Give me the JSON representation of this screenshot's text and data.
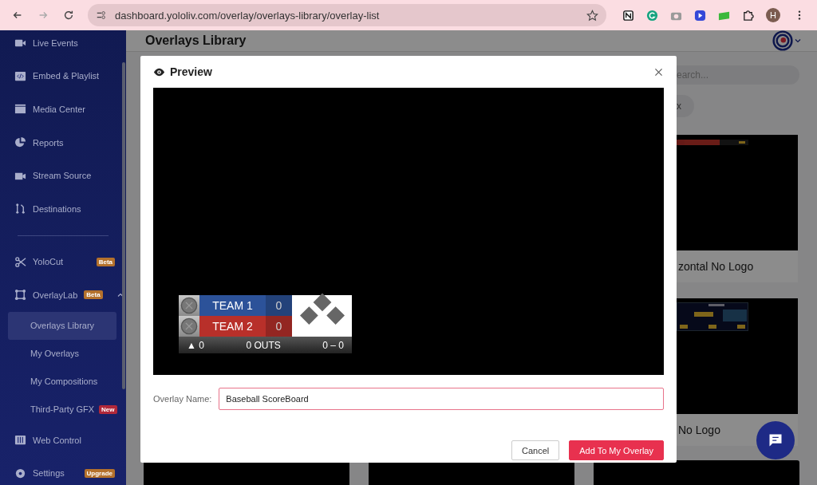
{
  "browser": {
    "url": "dashboard.yololiv.com/overlay/overlays-library/overlay-list",
    "forward_disabled": true,
    "avatar": "H"
  },
  "sidebar": {
    "items": [
      {
        "label": "Live Events"
      },
      {
        "label": "Embed & Playlist"
      },
      {
        "label": "Media Center"
      },
      {
        "label": "Reports"
      },
      {
        "label": "Stream Source"
      },
      {
        "label": "Destinations"
      },
      {
        "label": "YoloCut",
        "badge": {
          "text": "Beta",
          "color": "#b4712c"
        }
      },
      {
        "label": "OverlayLab",
        "badge": {
          "text": "Beta",
          "color": "#b4712c"
        },
        "expanded": true,
        "children": [
          {
            "label": "Overlays Library",
            "selected": true
          },
          {
            "label": "My Overlays",
            "selected": false
          },
          {
            "label": "My Compositions",
            "selected": false
          },
          {
            "label": "Third-Party GFX",
            "selected": false,
            "badge": {
              "text": "New",
              "color": "#b0283a"
            }
          }
        ]
      },
      {
        "label": "Web Control"
      },
      {
        "label": "Settings",
        "badge": {
          "text": "Upgrade",
          "color": "#b4712c"
        }
      }
    ]
  },
  "page": {
    "title": "Overlays Library",
    "search": {
      "placeholder": "earch..."
    },
    "chip": "x",
    "cards": [
      {
        "title": "zontal No Logo",
        "thumb": {
          "kind": "bar"
        }
      },
      {
        "title": "No Logo",
        "thumb": {
          "kind": "panel"
        }
      }
    ]
  },
  "modal": {
    "title": "Preview",
    "scoreboard": {
      "teams": [
        {
          "name": "TEAM 1",
          "score": "0",
          "color": "#2c5299"
        },
        {
          "name": "TEAM 2",
          "score": "0",
          "color": "#b8302a"
        }
      ],
      "inning_marker": "▲",
      "inning": "0",
      "outs": "0 OUTS",
      "count": "0 – 0"
    },
    "name_label": "Overlay Name:",
    "name_value": "Baseball ScoreBoard",
    "buttons": [
      {
        "label": "Cancel",
        "kind": "secondary"
      },
      {
        "label": "Add To My Overlay",
        "kind": "primary"
      }
    ]
  }
}
